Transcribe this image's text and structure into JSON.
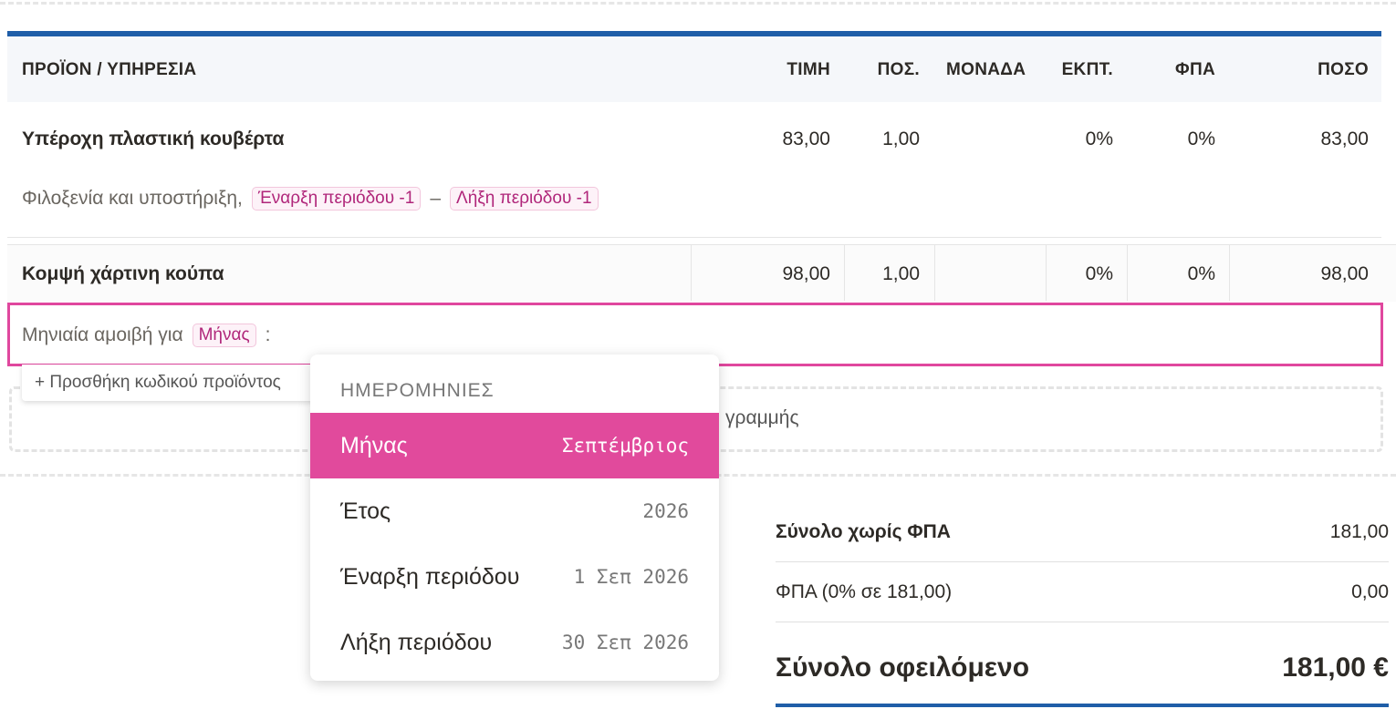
{
  "table": {
    "headers": {
      "product": "ΠΡΟΪΟΝ / ΥΠΗΡΕΣΙΑ",
      "price": "ΤΙΜΗ",
      "qty": "ΠΟΣ.",
      "unit": "ΜΟΝΑΔΑ",
      "discount": "ΕΚΠΤ.",
      "vat": "ΦΠΑ",
      "amount": "ΠΟΣΟ"
    },
    "rows": [
      {
        "name": "Υπέροχη πλαστική κουβέρτα",
        "price": "83,00",
        "qty": "1,00",
        "unit": "",
        "discount": "0%",
        "vat": "0%",
        "amount": "83,00",
        "description_text": "Φιλοξενία και υποστήριξη,",
        "chip_start": "Έναρξη περιόδου -1",
        "dash": "–",
        "chip_end": "Λήξη περιόδου -1"
      },
      {
        "name": "Κομψή χάρτινη κούπα",
        "price": "98,00",
        "qty": "1,00",
        "unit": "",
        "discount": "0%",
        "vat": "0%",
        "amount": "98,00",
        "description_text": "Μηνιαία αμοιβή για",
        "chip": "Μήνας",
        "suffix": ":"
      }
    ]
  },
  "add_product_code": "+ Προσθήκη κωδικού προϊόντος",
  "add_line_text": "γραμμής",
  "dropdown": {
    "header": "ΗΜΕΡΟΜΗΝΙΕΣ",
    "items": [
      {
        "label": "Μήνας",
        "value": "Σεπτέμβριος",
        "selected": true
      },
      {
        "label": "Έτος",
        "value": "2026",
        "selected": false
      },
      {
        "label": "Έναρξη περιόδου",
        "value": "1 Σεπ 2026",
        "selected": false
      },
      {
        "label": "Λήξη περιόδου",
        "value": "30 Σεπ 2026",
        "selected": false
      }
    ]
  },
  "totals": {
    "subtotal_label": "Σύνολο χωρίς ΦΠΑ",
    "subtotal_value": "181,00",
    "vat_label": "ΦΠΑ (0% σε 181,00)",
    "vat_value": "0,00",
    "total_label": "Σύνολο οφειλόμενο",
    "total_value": "181,00 €"
  },
  "colors": {
    "accent_blue": "#1f5ea8",
    "accent_pink": "#e14a9c"
  }
}
